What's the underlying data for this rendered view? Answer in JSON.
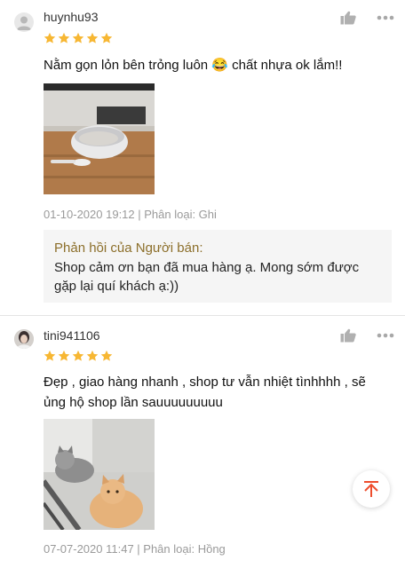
{
  "reviews": [
    {
      "username": "huynhu93",
      "rating": 5,
      "text": "Nằm gọn lỏn bên trỏng luôn 😂 chất nhựa ok lắm!!",
      "meta": "01-10-2020 19:12 | Phân loại: Ghi",
      "reply": {
        "title": "Phản hồi của Người bán:",
        "text": "Shop cảm ơn bạn đã mua hàng ạ. Mong sớm được gặp lại quí khách ạ:))"
      },
      "icons": {
        "like": "thumbs-up-icon",
        "more": "more-dots-icon",
        "avatar": "default-avatar-icon"
      }
    },
    {
      "username": "tini941106",
      "rating": 5,
      "text": "Đẹp , giao hàng nhanh , shop tư vẫn nhiệt tìnhhhh , sẽ ủng hộ shop lần sauuuuuuuuu",
      "meta": "07-07-2020 11:47 | Phân loại: Hồng",
      "icons": {
        "like": "thumbs-up-icon",
        "more": "more-dots-icon",
        "avatar": "user-photo-avatar"
      }
    }
  ],
  "scroll_top": {
    "icon": "arrow-up-icon",
    "color": "#ee4d2d"
  },
  "colors": {
    "star": "#f7b733",
    "reply_title": "#8c6f2b",
    "meta": "#9a9a9a"
  }
}
